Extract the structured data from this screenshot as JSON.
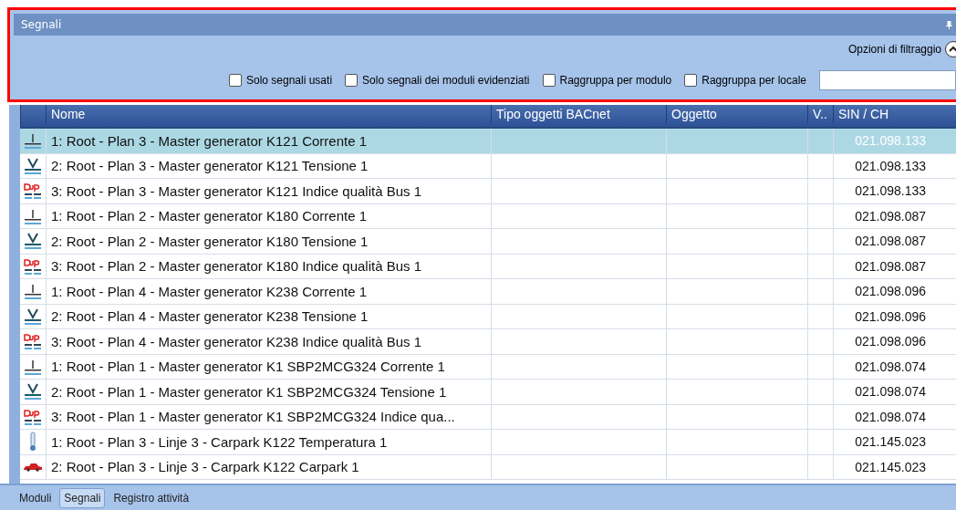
{
  "panel": {
    "title": "Segnali",
    "filter_toggle": "Opzioni di filtraggio"
  },
  "filters": [
    {
      "label": "Solo segnali usati",
      "checked": false
    },
    {
      "label": "Solo segnali dei moduli evidenziati",
      "checked": false
    },
    {
      "label": "Raggruppa per modulo",
      "checked": false
    },
    {
      "label": "Raggruppa per locale",
      "checked": false
    }
  ],
  "table": {
    "columns": [
      "Nome",
      "Tipo oggetti BACnet",
      "Oggetto",
      "V..",
      "SIN / CH"
    ],
    "rows": [
      {
        "kind": "current",
        "name": "1: Root - Plan 3 - Master generator K121 Corrente 1",
        "sin": "021.098.133",
        "selected": true
      },
      {
        "kind": "voltage",
        "name": "2: Root - Plan 3 - Master generator K121 Tensione 1",
        "sin": "021.098.133",
        "selected": false
      },
      {
        "kind": "dup",
        "name": "3: Root - Plan 3 - Master generator K121 Indice qualità Bus 1",
        "sin": "021.098.133",
        "selected": false
      },
      {
        "kind": "current",
        "name": "1: Root - Plan 2 - Master generator K180 Corrente 1",
        "sin": "021.098.087",
        "selected": false
      },
      {
        "kind": "voltage",
        "name": "2: Root - Plan 2 - Master generator K180 Tensione 1",
        "sin": "021.098.087",
        "selected": false
      },
      {
        "kind": "dup",
        "name": "3: Root - Plan 2 - Master generator K180 Indice qualità Bus 1",
        "sin": "021.098.087",
        "selected": false
      },
      {
        "kind": "current",
        "name": "1: Root - Plan 4 - Master generator K238 Corrente 1",
        "sin": "021.098.096",
        "selected": false
      },
      {
        "kind": "voltage",
        "name": "2: Root - Plan 4 - Master generator K238 Tensione 1",
        "sin": "021.098.096",
        "selected": false
      },
      {
        "kind": "dup",
        "name": "3: Root - Plan 4 - Master generator K238 Indice qualità Bus 1",
        "sin": "021.098.096",
        "selected": false
      },
      {
        "kind": "current",
        "name": "1: Root - Plan 1 - Master generator K1 SBP2MCG324 Corrente 1",
        "sin": "021.098.074",
        "selected": false
      },
      {
        "kind": "voltage",
        "name": "2: Root - Plan 1 - Master generator K1 SBP2MCG324 Tensione 1",
        "sin": "021.098.074",
        "selected": false
      },
      {
        "kind": "dup",
        "name": "3: Root - Plan 1 - Master generator K1 SBP2MCG324 Indice qua...",
        "sin": "021.098.074",
        "selected": false
      },
      {
        "kind": "temperature",
        "name": "1: Root - Plan 3 - Linje 3 - Carpark K122 Temperatura 1",
        "sin": "021.145.023",
        "selected": false
      },
      {
        "kind": "car",
        "name": "2: Root - Plan 3 - Linje 3 - Carpark K122 Carpark 1",
        "sin": "021.145.023",
        "selected": false
      }
    ]
  },
  "bottom_tabs": [
    {
      "label": "Moduli",
      "selected": false
    },
    {
      "label": "Segnali",
      "selected": true
    },
    {
      "label": "Registro attività",
      "selected": false
    }
  ]
}
